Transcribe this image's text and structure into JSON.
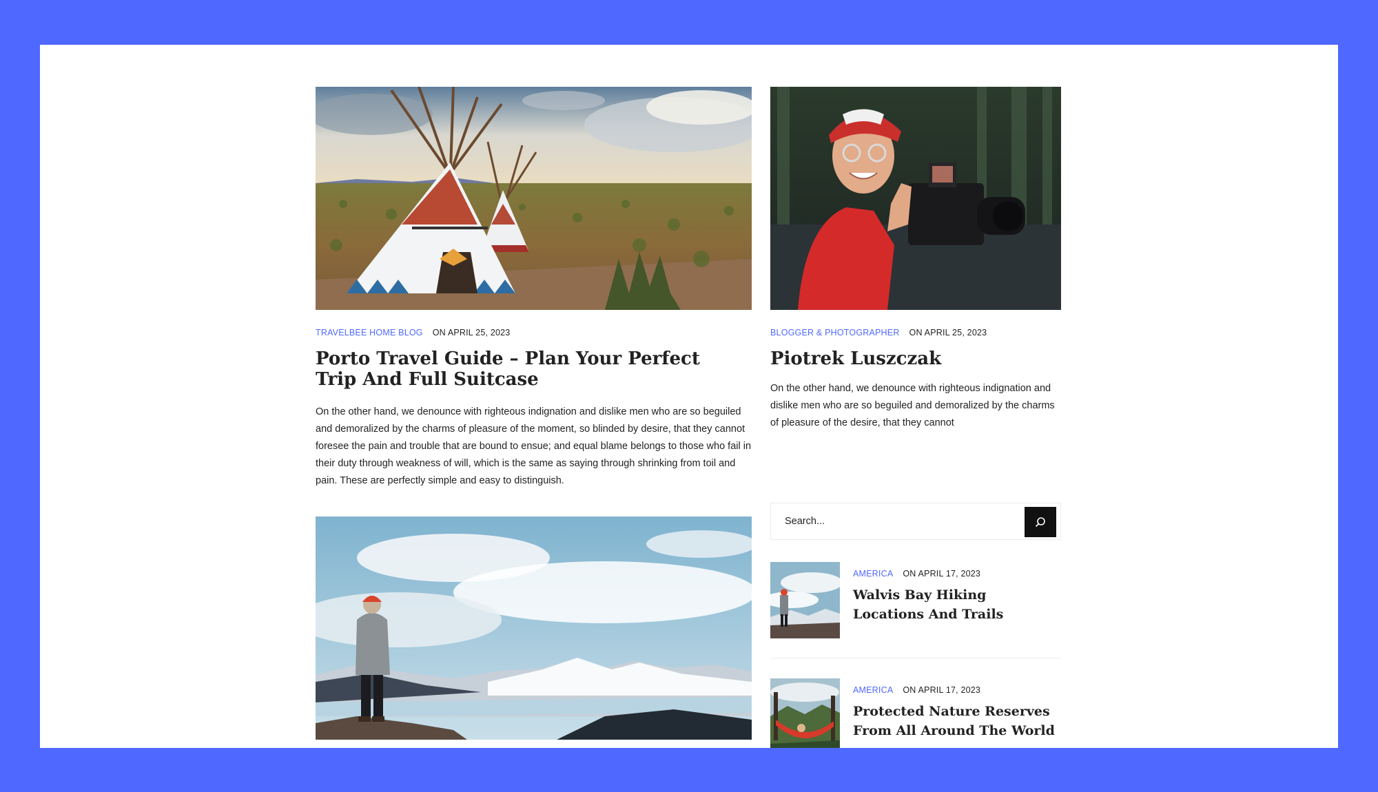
{
  "colors": {
    "background": "#4f68ff",
    "accent": "#4f68ff",
    "text": "#222222",
    "search_button": "#111111"
  },
  "featured_post": {
    "category": "TRAVELBEE HOME BLOG",
    "date": "ON APRIL 25, 2023",
    "title": "Porto Travel Guide – Plan Your Perfect Trip And Full Suitcase",
    "excerpt": "On the other hand, we denounce with righteous indignation and dislike men who are so beguiled and demoralized by the charms of pleasure of the moment, so blinded by desire, that they cannot foresee the pain and trouble that are bound to ensue; and equal blame belongs to those who fail in their duty through weakness of will, which is the same as saying through shrinking from toil and pain. These are perfectly simple and easy to distinguish.",
    "image": "teepee-desert-photo"
  },
  "second_post": {
    "image": "hiker-mountain-lake-photo"
  },
  "author": {
    "category": "BLOGGER & PHOTOGRAPHER",
    "date": "ON APRIL 25, 2023",
    "name": "Piotrek Luszczak",
    "bio": "On the other hand, we denounce with righteous indignation and dislike men who are so beguiled and demoralized by the charms of pleasure of the desire, that they cannot",
    "image": "photographer-with-camera-photo"
  },
  "search": {
    "placeholder": "Search...",
    "icon": "search-icon"
  },
  "recent_posts": [
    {
      "category": "AMERICA",
      "date": "ON APRIL 17, 2023",
      "title": "Walvis Bay Hiking Locations And Trails",
      "image": "hiker-thumbnail"
    },
    {
      "category": "AMERICA",
      "date": "ON APRIL 17, 2023",
      "title": "Protected Nature Reserves From All Around The World",
      "image": "hammock-thumbnail"
    }
  ]
}
